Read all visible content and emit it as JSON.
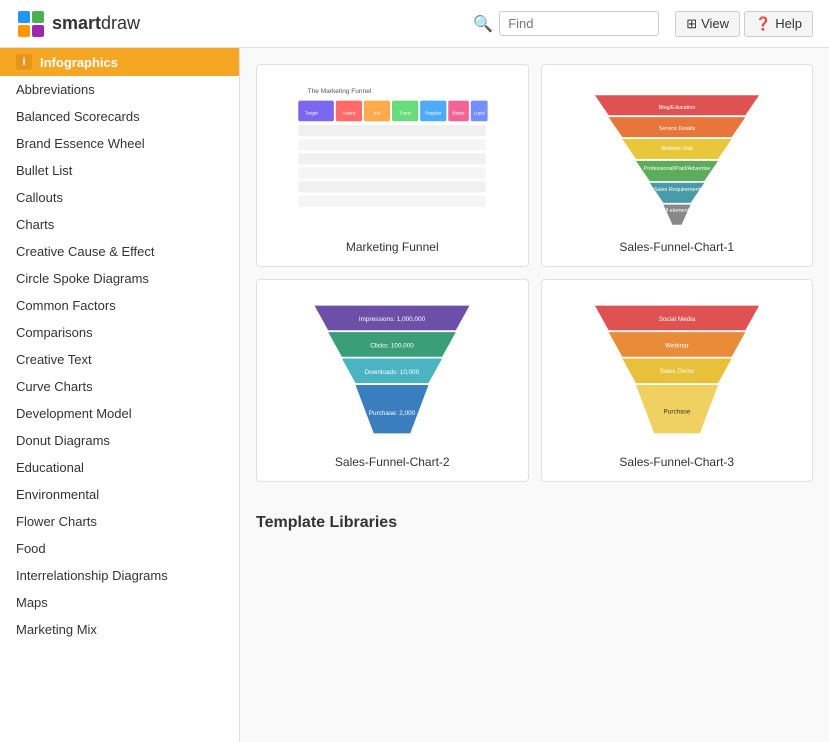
{
  "header": {
    "logo_bold": "smart",
    "logo_light": "draw",
    "search_placeholder": "Find",
    "view_label": "View",
    "help_label": "Help"
  },
  "sidebar": {
    "active_item": "Infographics",
    "items": [
      "Abbreviations",
      "Balanced Scorecards",
      "Brand Essence Wheel",
      "Bullet List",
      "Callouts",
      "Charts",
      "Creative Cause & Effect",
      "Circle Spoke Diagrams",
      "Common Factors",
      "Comparisons",
      "Creative Text",
      "Curve Charts",
      "Development Model",
      "Donut Diagrams",
      "Educational",
      "Environmental",
      "Flower Charts",
      "Food",
      "Interrelationship Diagrams",
      "Maps",
      "Marketing Mix"
    ]
  },
  "templates": [
    {
      "id": "marketing-funnel",
      "label": "Marketing Funnel",
      "type": "marketing-funnel"
    },
    {
      "id": "sales-funnel-1",
      "label": "Sales-Funnel-Chart-1",
      "type": "sales-funnel-1"
    },
    {
      "id": "sales-funnel-2",
      "label": "Sales-Funnel-Chart-2",
      "type": "sales-funnel-2"
    },
    {
      "id": "sales-funnel-3",
      "label": "Sales-Funnel-Chart-3",
      "type": "sales-funnel-3"
    }
  ],
  "section": {
    "libraries_title": "Template Libraries"
  }
}
